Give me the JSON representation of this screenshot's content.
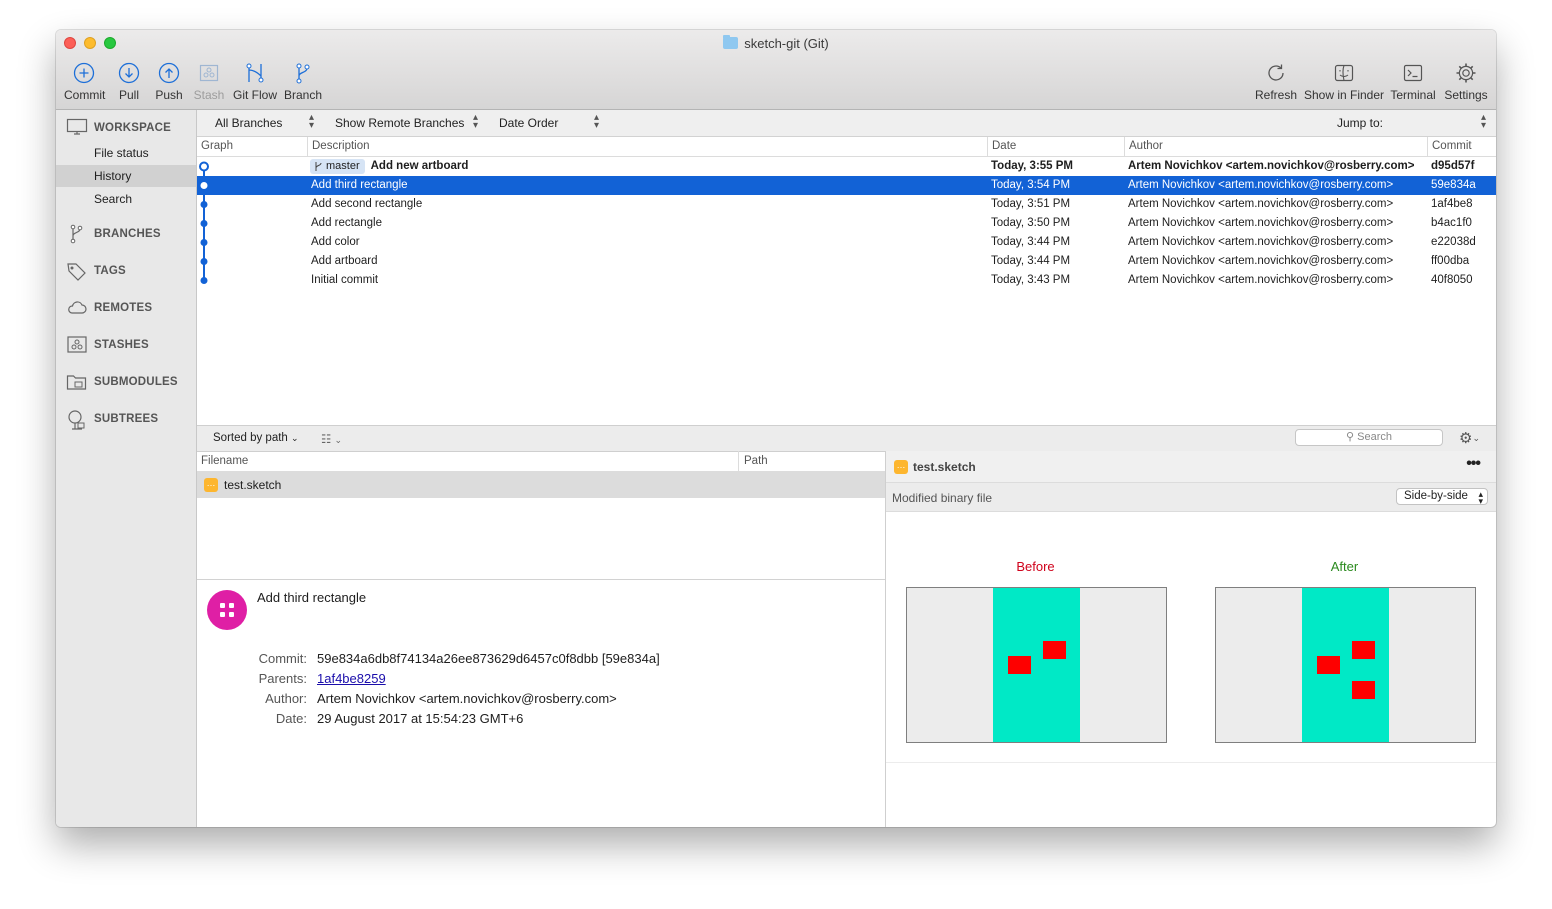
{
  "window": {
    "title": "sketch-git (Git)"
  },
  "toolbar": {
    "commit": "Commit",
    "pull": "Pull",
    "push": "Push",
    "stash": "Stash",
    "gitflow": "Git Flow",
    "branch": "Branch",
    "refresh": "Refresh",
    "show_in_finder": "Show in Finder",
    "terminal": "Terminal",
    "settings": "Settings"
  },
  "sidebar": {
    "workspace": "WORKSPACE",
    "items": [
      "File status",
      "History",
      "Search"
    ],
    "selected": "History",
    "sections": [
      "BRANCHES",
      "TAGS",
      "REMOTES",
      "STASHES",
      "SUBMODULES",
      "SUBTREES"
    ]
  },
  "filters": {
    "branches": "All Branches",
    "remote": "Show Remote Branches",
    "order": "Date Order",
    "jump_to": "Jump to:"
  },
  "columns": {
    "graph": "Graph",
    "description": "Description",
    "date": "Date",
    "author": "Author",
    "commit": "Commit"
  },
  "commits": [
    {
      "branch": "master",
      "description": "Add new artboard",
      "date": "Today, 3:55 PM",
      "author": "Artem Novichkov <artem.novichkov@rosberry.com>",
      "hash": "d95d57f"
    },
    {
      "description": "Add third rectangle",
      "date": "Today, 3:54 PM",
      "author": "Artem Novichkov <artem.novichkov@rosberry.com>",
      "hash": "59e834a"
    },
    {
      "description": "Add second rectangle",
      "date": "Today, 3:51 PM",
      "author": "Artem Novichkov <artem.novichkov@rosberry.com>",
      "hash": "1af4be8"
    },
    {
      "description": "Add rectangle",
      "date": "Today, 3:50 PM",
      "author": "Artem Novichkov <artem.novichkov@rosberry.com>",
      "hash": "b4ac1f0"
    },
    {
      "description": "Add color",
      "date": "Today, 3:44 PM",
      "author": "Artem Novichkov <artem.novichkov@rosberry.com>",
      "hash": "e22038d"
    },
    {
      "description": "Add artboard",
      "date": "Today, 3:44 PM",
      "author": "Artem Novichkov <artem.novichkov@rosberry.com>",
      "hash": "ff00dba"
    },
    {
      "description": "Initial commit",
      "date": "Today, 3:43 PM",
      "author": "Artem Novichkov <artem.novichkov@rosberry.com>",
      "hash": "40f8050"
    }
  ],
  "lower_toolbar": {
    "sort": "Sorted by path",
    "search_placeholder": "Search"
  },
  "files": {
    "col_filename": "Filename",
    "col_path": "Path",
    "items": [
      {
        "name": "test.sketch"
      }
    ]
  },
  "details": {
    "title": "Add third rectangle",
    "commit_label": "Commit:",
    "commit": "59e834a6db8f74134a26ee873629d6457c0f8dbb [59e834a]",
    "parents_label": "Parents:",
    "parents": "1af4be8259",
    "author_label": "Author:",
    "author": "Artem Novichkov <artem.novichkov@rosberry.com>",
    "date_label": "Date:",
    "date": "29 August 2017 at 15:54:23 GMT+6"
  },
  "diff": {
    "filename": "test.sketch",
    "status": "Modified binary file",
    "mode": "Side-by-side",
    "before_label": "Before",
    "after_label": "After",
    "colors": {
      "before": "#d0021b",
      "after": "#2a8a1e",
      "teal": "#00e9c6",
      "red": "#fe0000"
    }
  },
  "colors": {
    "selection": "#1262d6",
    "graph": "#1262d6"
  }
}
